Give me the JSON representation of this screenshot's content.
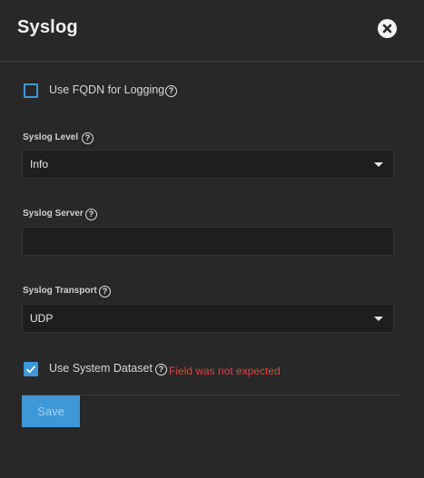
{
  "dialog": {
    "title": "Syslog",
    "close_icon": "close-icon"
  },
  "fqdn": {
    "label": "Use FQDN for Logging",
    "checked": false
  },
  "syslog_level": {
    "label": "Syslog Level",
    "value": "Info"
  },
  "syslog_server": {
    "label": "Syslog Server",
    "value": ""
  },
  "syslog_transport": {
    "label": "Syslog Transport",
    "value": "UDP"
  },
  "system_dataset": {
    "label": "Use System Dataset",
    "checked": true,
    "error": "Field was not expected"
  },
  "help_glyph": "?",
  "save_label": "Save",
  "colors": {
    "background": "#282828",
    "accent": "#3e97d6",
    "error": "#e04343",
    "input_bg": "#1e1e1e"
  }
}
